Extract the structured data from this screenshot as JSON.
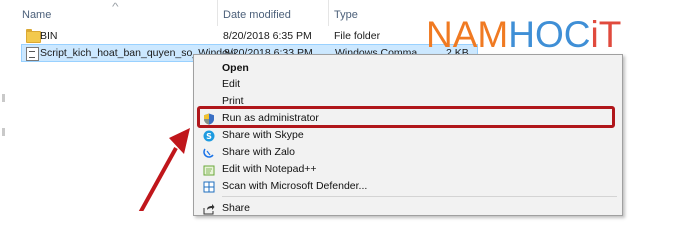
{
  "explorer": {
    "columns": {
      "name": "Name",
      "date_modified": "Date modified",
      "type": "Type"
    },
    "files": [
      {
        "name": "BIN",
        "date": "8/20/2018 6:35 PM",
        "type": "File folder",
        "size": ""
      },
      {
        "name": "Script_kich_hoat_ban_quyen_so_Window...",
        "date": "8/20/2018 6:33 PM",
        "type": "Windows Comma...",
        "size": "2 KB"
      }
    ]
  },
  "watermark": {
    "part1": "NAM",
    "part2": "HOC",
    "part3": "iT"
  },
  "context_menu": {
    "items": [
      {
        "label": "Open",
        "icon": ""
      },
      {
        "label": "Edit",
        "icon": ""
      },
      {
        "label": "Print",
        "icon": ""
      },
      {
        "label": "Run as administrator",
        "icon": "uac-shield-icon"
      },
      {
        "label": "Share with Skype",
        "icon": "skype-icon"
      },
      {
        "label": "Share with Zalo",
        "icon": "zalo-icon"
      },
      {
        "label": "Edit with Notepad++",
        "icon": "notepadpp-icon"
      },
      {
        "label": "Scan with Microsoft Defender...",
        "icon": "defender-icon"
      },
      {
        "label": "Share",
        "icon": "share-icon"
      }
    ]
  },
  "colors": {
    "highlight_box": "#b0161b",
    "arrow": "#c0161b",
    "selection": "#cce8ff"
  }
}
